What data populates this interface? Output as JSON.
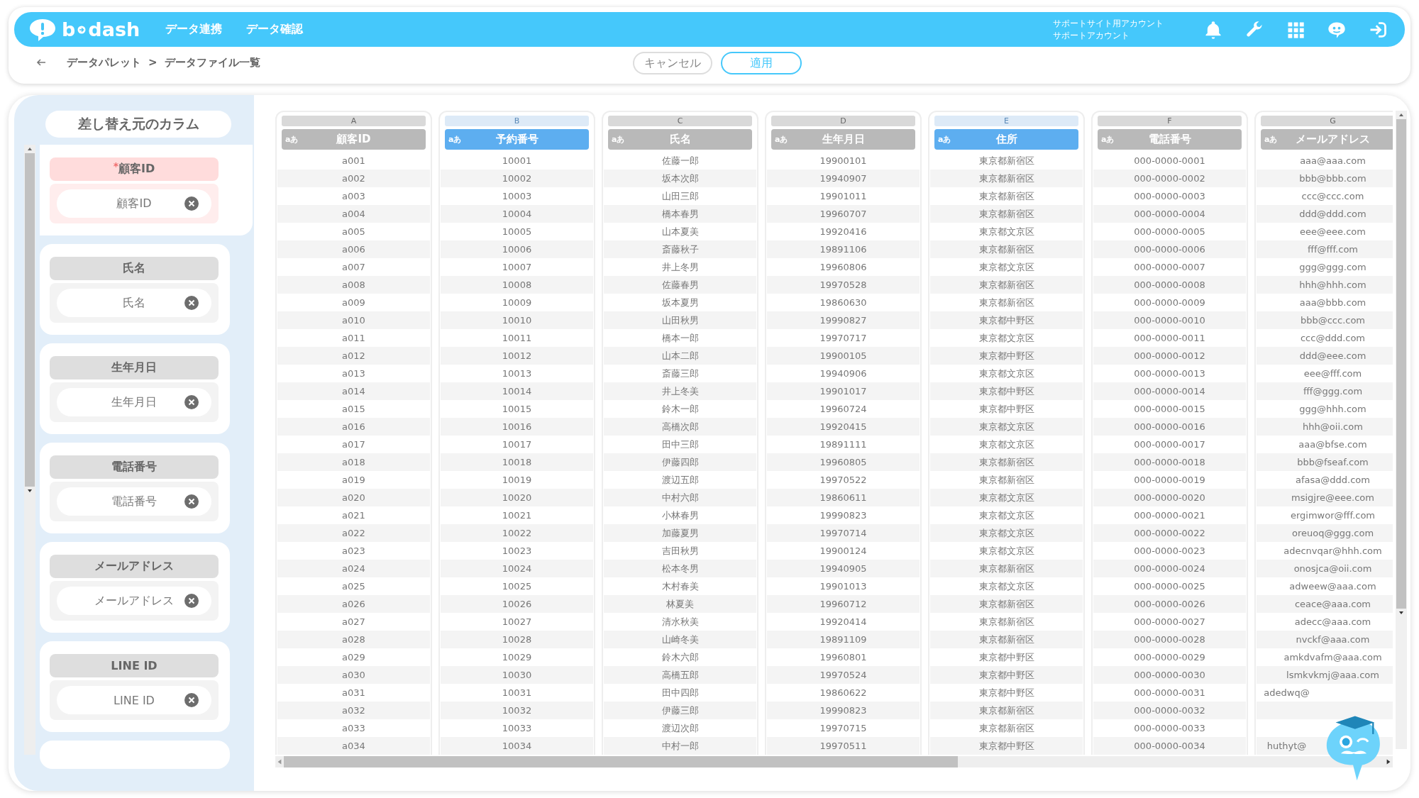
{
  "header": {
    "logo_left": "b",
    "logo_right": "dash",
    "nav": [
      {
        "label": "データ連携"
      },
      {
        "label": "データ確認"
      }
    ],
    "account": [
      "サポートサイト用アカウント",
      "サポートアカウント"
    ]
  },
  "breadcrumb": {
    "items": [
      "データパレット",
      "データファイル一覧"
    ],
    "separator": ">"
  },
  "actions": {
    "cancel": "キャンセル",
    "apply": "適用"
  },
  "source_panel": {
    "title": "差し替え元のカラム",
    "items": [
      {
        "header": "顧客ID",
        "value": "顧客ID",
        "required": true,
        "mark": "*"
      },
      {
        "header": "氏名",
        "value": "氏名",
        "required": false
      },
      {
        "header": "生年月日",
        "value": "生年月日",
        "required": false
      },
      {
        "header": "電話番号",
        "value": "電話番号",
        "required": false
      },
      {
        "header": "メールアドレス",
        "value": "メールアドレス",
        "required": false
      },
      {
        "header": "LINE ID",
        "value": "LINE ID",
        "required": false
      }
    ]
  },
  "table": {
    "columns": [
      {
        "letter": "A",
        "type_label": "aあ",
        "header": "顧客ID",
        "selected": false
      },
      {
        "letter": "B",
        "type_label": "aあ",
        "header": "予約番号",
        "selected": true
      },
      {
        "letter": "C",
        "type_label": "aあ",
        "header": "氏名",
        "selected": false
      },
      {
        "letter": "D",
        "type_label": "aあ",
        "header": "生年月日",
        "selected": false
      },
      {
        "letter": "E",
        "type_label": "aあ",
        "header": "住所",
        "selected": true
      },
      {
        "letter": "F",
        "type_label": "aあ",
        "header": "電話番号",
        "selected": false
      },
      {
        "letter": "G",
        "type_label": "aあ",
        "header": "メールアドレス",
        "selected": false
      }
    ],
    "rows": [
      [
        "a001",
        "10001",
        "佐藤一郎",
        "19900101",
        "東京都新宿区",
        "000-0000-0001",
        "aaa@aaa.com"
      ],
      [
        "a002",
        "10002",
        "坂本次郎",
        "19940907",
        "東京都新宿区",
        "000-0000-0002",
        "bbb@bbb.com"
      ],
      [
        "a003",
        "10003",
        "山田三郎",
        "19901011",
        "東京都新宿区",
        "000-0000-0003",
        "ccc@ccc.com"
      ],
      [
        "a004",
        "10004",
        "橋本春男",
        "19960707",
        "東京都新宿区",
        "000-0000-0004",
        "ddd@ddd.com"
      ],
      [
        "a005",
        "10005",
        "山本夏美",
        "19920416",
        "東京都文京区",
        "000-0000-0005",
        "eee@eee.com"
      ],
      [
        "a006",
        "10006",
        "斎藤秋子",
        "19891106",
        "東京都新宿区",
        "000-0000-0006",
        "fff@fff.com"
      ],
      [
        "a007",
        "10007",
        "井上冬男",
        "19960806",
        "東京都文京区",
        "000-0000-0007",
        "ggg@ggg.com"
      ],
      [
        "a008",
        "10008",
        "佐藤春男",
        "19970528",
        "東京都新宿区",
        "000-0000-0008",
        "hhh@hhh.com"
      ],
      [
        "a009",
        "10009",
        "坂本夏男",
        "19860630",
        "東京都新宿区",
        "000-0000-0009",
        "aaa@bbb.com"
      ],
      [
        "a010",
        "10010",
        "山田秋男",
        "19990827",
        "東京都中野区",
        "000-0000-0010",
        "bbb@ccc.com"
      ],
      [
        "a011",
        "10011",
        "橋本一郎",
        "19970717",
        "東京都文京区",
        "000-0000-0011",
        "ccc@ddd.com"
      ],
      [
        "a012",
        "10012",
        "山本二郎",
        "19900105",
        "東京都中野区",
        "000-0000-0012",
        "ddd@eee.com"
      ],
      [
        "a013",
        "10013",
        "斎藤三郎",
        "19940906",
        "東京都文京区",
        "000-0000-0013",
        "eee@fff.com"
      ],
      [
        "a014",
        "10014",
        "井上冬美",
        "19901017",
        "東京都中野区",
        "000-0000-0014",
        "fff@ggg.com"
      ],
      [
        "a015",
        "10015",
        "鈴木一郎",
        "19960724",
        "東京都中野区",
        "000-0000-0015",
        "ggg@hhh.com"
      ],
      [
        "a016",
        "10016",
        "高橋次郎",
        "19920415",
        "東京都文京区",
        "000-0000-0016",
        "hhh@oii.com"
      ],
      [
        "a017",
        "10017",
        "田中三郎",
        "19891111",
        "東京都文京区",
        "000-0000-0017",
        "aaa@bfse.com"
      ],
      [
        "a018",
        "10018",
        "伊藤四郎",
        "19960805",
        "東京都新宿区",
        "000-0000-0018",
        "bbb@fseaf.com"
      ],
      [
        "a019",
        "10019",
        "渡辺五郎",
        "19970522",
        "東京都新宿区",
        "000-0000-0019",
        "afasa@ddd.com"
      ],
      [
        "a020",
        "10020",
        "中村六郎",
        "19860611",
        "東京都文京区",
        "000-0000-0020",
        "msigjre@eee.com"
      ],
      [
        "a021",
        "10021",
        "小林春男",
        "19990823",
        "東京都文京区",
        "000-0000-0021",
        "ergimwor@fff.com"
      ],
      [
        "a022",
        "10022",
        "加藤夏男",
        "19970714",
        "東京都文京区",
        "000-0000-0022",
        "oreuoq@ggg.com"
      ],
      [
        "a023",
        "10023",
        "吉田秋男",
        "19900124",
        "東京都文京区",
        "000-0000-0023",
        "adecnvqar@hhh.com"
      ],
      [
        "a024",
        "10024",
        "松本冬男",
        "19940905",
        "東京都新宿区",
        "000-0000-0024",
        "onosjca@oii.com"
      ],
      [
        "a025",
        "10025",
        "木村春美",
        "19901013",
        "東京都文京区",
        "000-0000-0025",
        "adweew@aaa.com"
      ],
      [
        "a026",
        "10026",
        "林夏美",
        "19960712",
        "東京都新宿区",
        "000-0000-0026",
        "ceace@aaa.com"
      ],
      [
        "a027",
        "10027",
        "清水秋美",
        "19920414",
        "東京都新宿区",
        "000-0000-0027",
        "adecc@aaa.com"
      ],
      [
        "a028",
        "10028",
        "山崎冬美",
        "19891109",
        "東京都新宿区",
        "000-0000-0028",
        "nvckf@aaa.com"
      ],
      [
        "a029",
        "10029",
        "鈴木六郎",
        "19960801",
        "東京都中野区",
        "000-0000-0029",
        "amkdvafm@aaa.com"
      ],
      [
        "a030",
        "10030",
        "高橋五郎",
        "19970524",
        "東京都中野区",
        "000-0000-0030",
        "lsmkvkmj@aaa.com"
      ],
      [
        "a031",
        "10031",
        "田中四郎",
        "19860622",
        "東京都中野区",
        "000-0000-0031",
        "adedwq@"
      ],
      [
        "a032",
        "10032",
        "伊藤三郎",
        "19990823",
        "東京都新宿区",
        "000-0000-0032"
      ],
      [
        "a033",
        "10033",
        "渡辺次郎",
        "19970715",
        "東京都新宿区",
        "000-0000-0033"
      ],
      [
        "a034",
        "10034",
        "中村一郎",
        "19970511",
        "東京都中野区",
        "000-0000-0034",
        "huthyt@"
      ]
    ]
  }
}
